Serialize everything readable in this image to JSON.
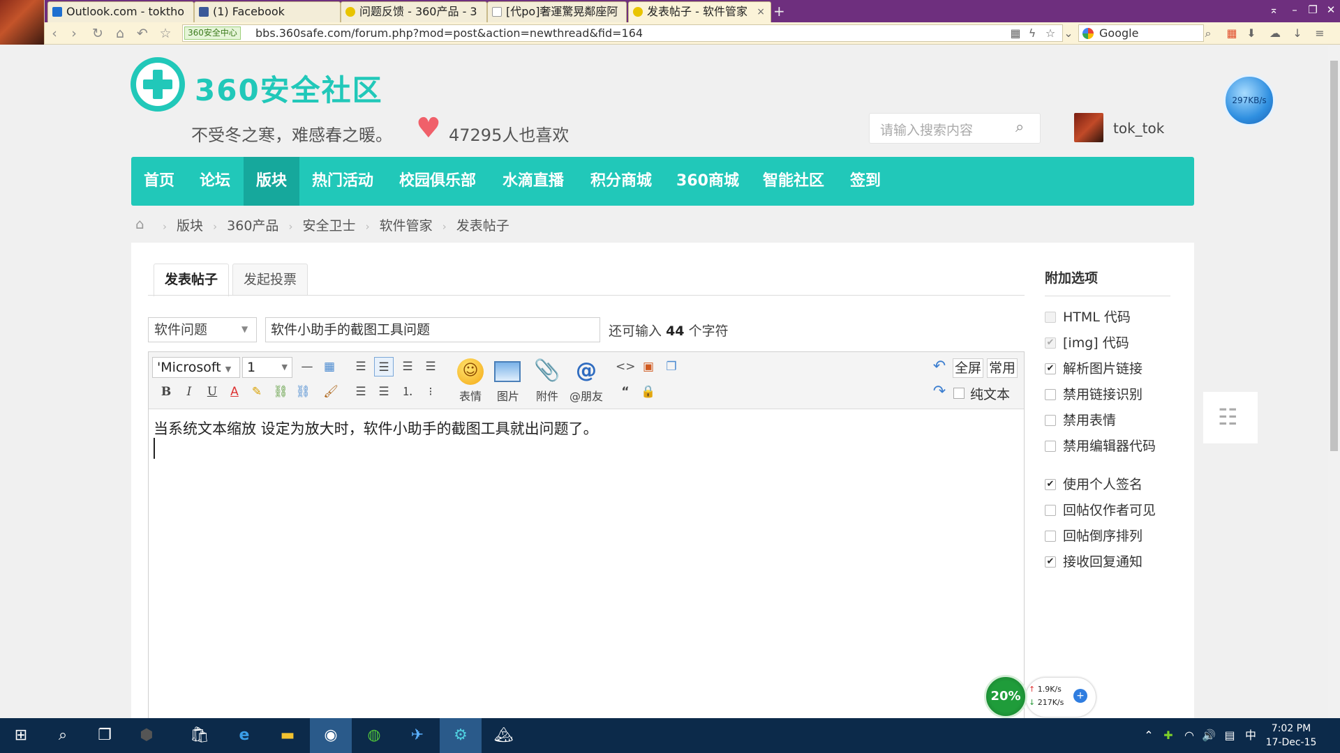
{
  "browser": {
    "tabs": [
      {
        "label": "Outlook.com - toktho",
        "icon_color": "#1e6fd0",
        "icon": "outlook-icon"
      },
      {
        "label": "(1) Facebook",
        "icon_color": "#3b5998",
        "icon": "facebook-icon"
      },
      {
        "label": "问题反馈 - 360产品 - 3",
        "icon_color": "#e8c400",
        "icon": "smiley-icon"
      },
      {
        "label": "[代po]奢運驚晃鄰座阿",
        "icon_color": "#ffffff",
        "icon": "page-icon"
      },
      {
        "label": "发表帖子 - 软件管家",
        "icon_color": "#e8c400",
        "icon": "smiley-icon"
      }
    ],
    "close_glyph": "×",
    "newtab_glyph": "+",
    "address_badge": "360安全中心",
    "url": "bbs.360safe.com/forum.php?mod=post&action=newthread&fid=164",
    "search_engine": "Google"
  },
  "site": {
    "logo_text": "360安全社区",
    "slogan": "不受冬之寒，难感春之暖。",
    "likes": "47295人也喜欢",
    "search_placeholder": "请输入搜索内容",
    "username": "tok_tok",
    "speed": "297KB/s",
    "nav": [
      "首页",
      "论坛",
      "版块",
      "热门活动",
      "校园俱乐部",
      "水滴直播",
      "积分商城",
      "360商城",
      "智能社区",
      "签到"
    ],
    "nav_current": "版块",
    "breadcrumb": [
      "版块",
      "360产品",
      "安全卫士",
      "软件管家",
      "发表帖子"
    ]
  },
  "post": {
    "tabs": [
      "发表帖子",
      "发起投票"
    ],
    "category": "软件问题",
    "title": "软件小助手的截图工具问题",
    "remain_prefix": "还可输入",
    "remain_count": "44",
    "remain_suffix": "个字符",
    "font": "'Microsoft",
    "size": "1",
    "tool_labels": {
      "emoji": "表情",
      "image": "图片",
      "attach": "附件",
      "friend": "@朋友"
    },
    "fullscreen": "全屏",
    "common": "常用",
    "plain_text": "纯文本",
    "body": "当系统文本缩放 设定为放大时，软件小助手的截图工具就出问题了。"
  },
  "sidebar": {
    "title": "附加选项",
    "options": [
      {
        "label": "HTML 代码",
        "checked": false,
        "disabled": true
      },
      {
        "label": "[img] 代码",
        "checked": true,
        "disabled": true
      },
      {
        "label": "解析图片链接",
        "checked": true,
        "disabled": false
      },
      {
        "label": "禁用链接识别",
        "checked": false,
        "disabled": false
      },
      {
        "label": "禁用表情",
        "checked": false,
        "disabled": false
      },
      {
        "label": "禁用编辑器代码",
        "checked": false,
        "disabled": false
      },
      {
        "label": "使用个人签名",
        "checked": true,
        "disabled": false
      },
      {
        "label": "回帖仅作者可见",
        "checked": false,
        "disabled": false
      },
      {
        "label": "回帖倒序排列",
        "checked": false,
        "disabled": false
      },
      {
        "label": "接收回复通知",
        "checked": true,
        "disabled": false
      }
    ]
  },
  "netmon": {
    "percent": "20%",
    "up": "1.9K/s",
    "down": "217K/s"
  },
  "taskbar": {
    "time": "7:02 PM",
    "date": "17-Dec-15",
    "ime": "中"
  },
  "colors": {
    "brand": "#21c8b9",
    "brand_dark": "#16a89c",
    "titlebar": "#6e2f7e"
  }
}
